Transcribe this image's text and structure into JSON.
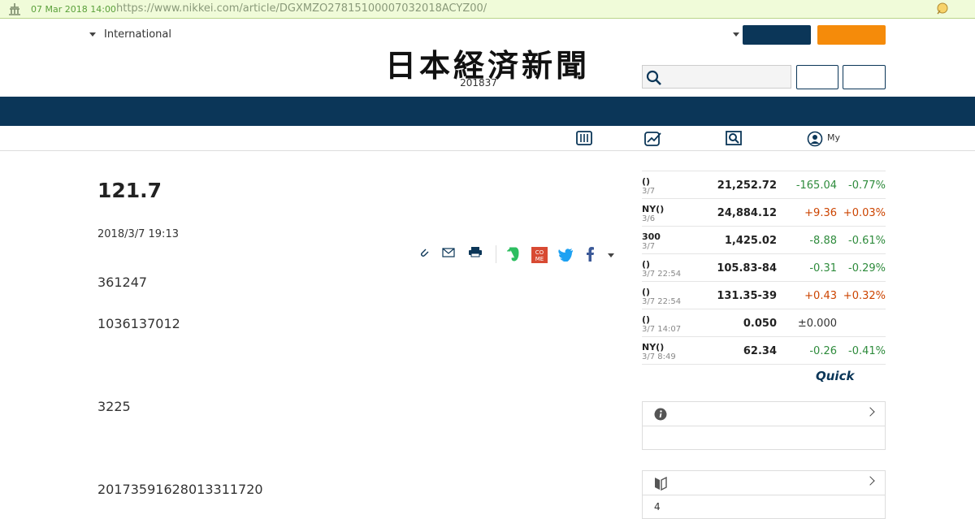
{
  "wayback": {
    "date": "07 Mar 2018 14:00",
    "url": "https://www.nikkei.com/article/DGXMZO27815100007032018ACYZ00/"
  },
  "header": {
    "edition": "International",
    "masthead": "日本経済新聞",
    "issue_date": "201837"
  },
  "subnav": {
    "my_label": "My"
  },
  "article": {
    "headline": "121.7",
    "date": "2018/3/7 19:13",
    "paragraphs": [
      "361247",
      "1036137012",
      "3225",
      "20173591628013311720"
    ]
  },
  "market": {
    "rows": [
      {
        "name": "()",
        "sub": "3/7",
        "value": "21,252.72",
        "change": "-165.04",
        "pct": "-0.77%",
        "dir": "neg"
      },
      {
        "name": "NY()",
        "sub": "3/6",
        "value": "24,884.12",
        "change": "+9.36",
        "pct": "+0.03%",
        "dir": "pos"
      },
      {
        "name": "300",
        "sub": "3/7",
        "value": "1,425.02",
        "change": "-8.88",
        "pct": "-0.61%",
        "dir": "neg"
      },
      {
        "name": "()",
        "sub": "3/7 22:54",
        "value": "105.83-84",
        "change": "-0.31",
        "pct": "-0.29%",
        "dir": "neg"
      },
      {
        "name": "()",
        "sub": "3/7 22:54",
        "value": "131.35-39",
        "change": "+0.43",
        "pct": "+0.32%",
        "dir": "pos"
      },
      {
        "name": "()",
        "sub": "3/7 14:07",
        "value": "0.050",
        "change": "±0.000",
        "pct": "",
        "dir": "flat"
      },
      {
        "name": "NY()",
        "sub": "3/7 8:49",
        "value": "62.34",
        "change": "-0.26",
        "pct": "-0.41%",
        "dir": "neg"
      }
    ],
    "source": "Quick"
  },
  "sidebar": {
    "box2_count": "4"
  },
  "colors": {
    "navy": "#0b3658",
    "orange": "#f58b0a",
    "down": "#2e8b3c",
    "up": "#cc4400"
  }
}
